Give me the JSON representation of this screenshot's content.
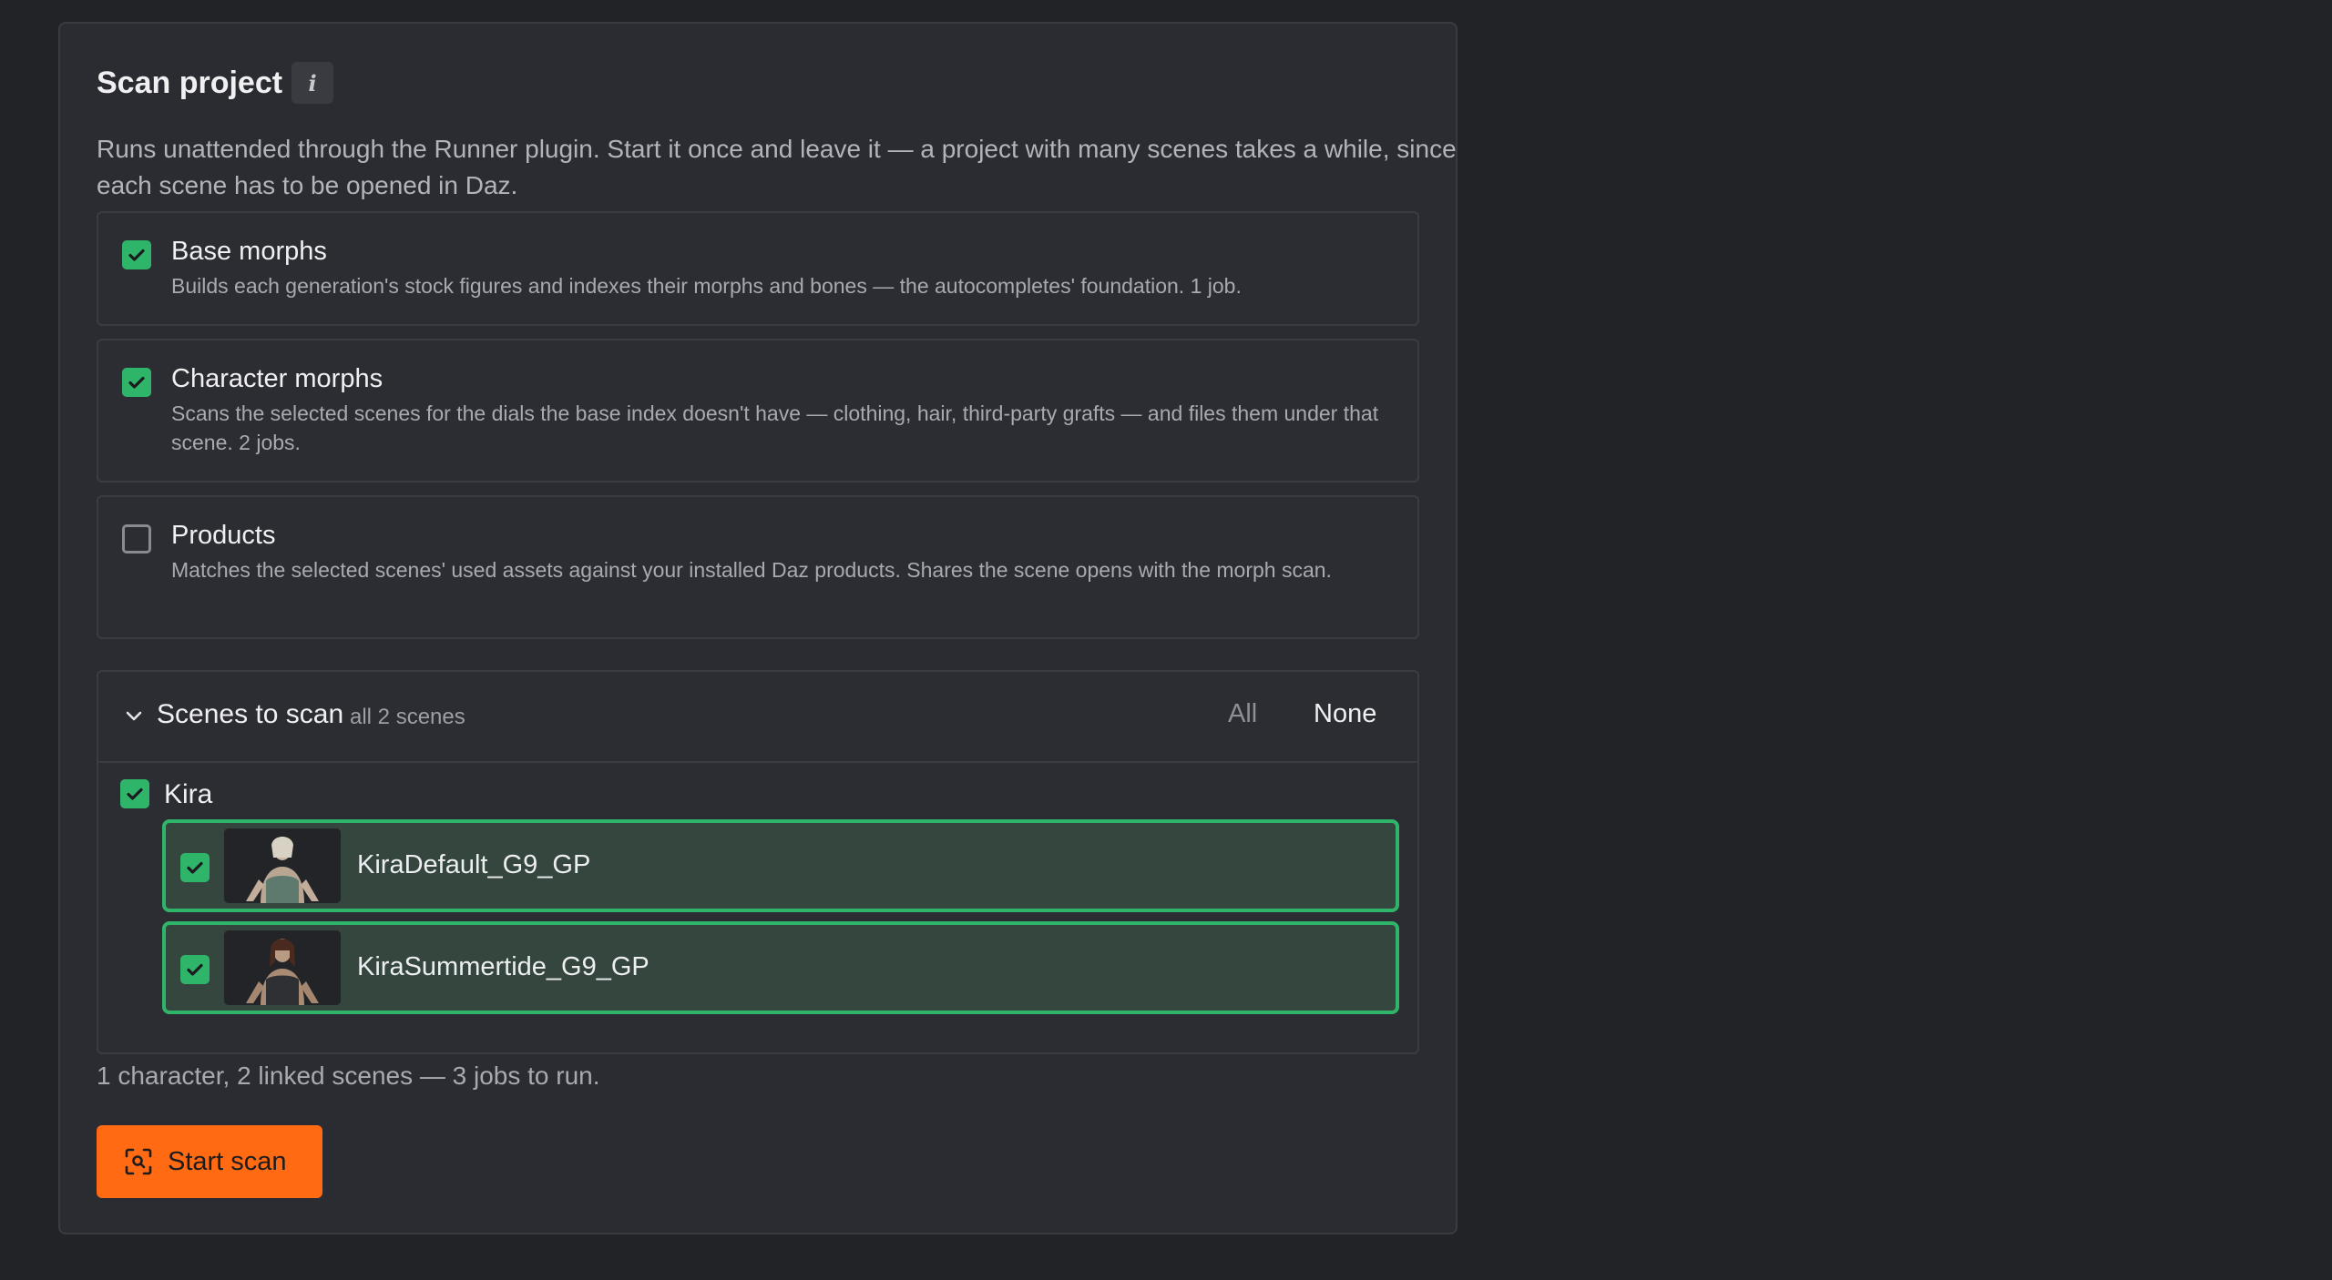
{
  "panel": {
    "title": "Scan project",
    "info_glyph": "i",
    "description": "Runs unattended through the Runner plugin. Start it once and leave it — a project with many scenes takes a while, since each scene has to be opened in Daz."
  },
  "options": [
    {
      "label": "Base morphs",
      "checked": true,
      "description": "Builds each generation's stock figures and indexes their morphs and bones — the autocompletes' foundation. 1 job."
    },
    {
      "label": "Character morphs",
      "checked": true,
      "description": "Scans the selected scenes for the dials the base index doesn't have — clothing, hair, third-party grafts — and files them under that scene. 2 jobs."
    },
    {
      "label": "Products",
      "checked": false,
      "description": "Matches the selected scenes' used assets against your installed Daz products. Shares the scene opens with the morph scan."
    }
  ],
  "scenes": {
    "title": "Scenes to scan",
    "count": "all 2 scenes",
    "all_label": "All",
    "none_label": "None",
    "group": {
      "label": "Kira",
      "checked": true,
      "items": [
        {
          "name": "KiraDefault_G9_GP",
          "checked": true
        },
        {
          "name": "KiraSummertide_G9_GP",
          "checked": true
        }
      ]
    }
  },
  "summary": "1 character, 2 linked scenes — 3 jobs to run.",
  "start_button": {
    "label": "Start scan",
    "icon": "scan-icon"
  },
  "colors": {
    "accent_green": "#2fb56a",
    "primary_orange": "#ff6a13",
    "panel_bg": "#2b2c31",
    "page_bg": "#222327"
  }
}
